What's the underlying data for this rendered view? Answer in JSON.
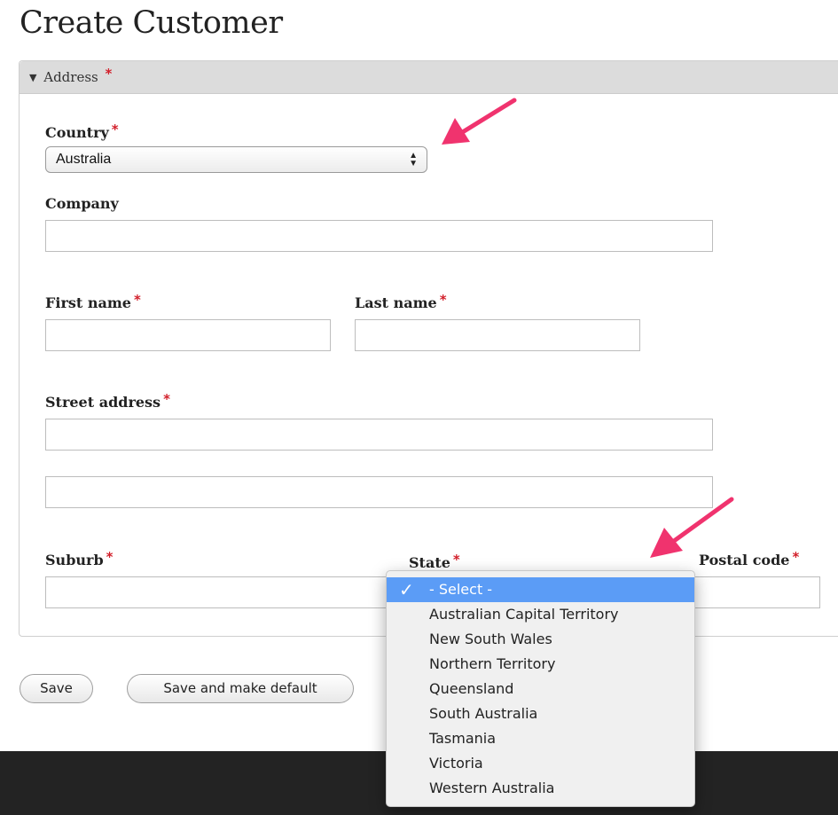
{
  "page_title": "Create Customer",
  "address_section": {
    "legend_label": "Address",
    "required_mark": "*",
    "country": {
      "label": "Country",
      "selected": "Australia"
    },
    "company": {
      "label": "Company",
      "value": ""
    },
    "first_name": {
      "label": "First name",
      "value": ""
    },
    "last_name": {
      "label": "Last name",
      "value": ""
    },
    "street_address": {
      "label": "Street address",
      "line1": "",
      "line2": ""
    },
    "suburb": {
      "label": "Suburb",
      "value": ""
    },
    "state": {
      "label": "State",
      "selected": "- Select -",
      "options": [
        "- Select -",
        "Australian Capital Territory",
        "New South Wales",
        "Northern Territory",
        "Queensland",
        "South Australia",
        "Tasmania",
        "Victoria",
        "Western Australia"
      ]
    },
    "postal_code": {
      "label": "Postal code",
      "value": ""
    }
  },
  "buttons": {
    "save": "Save",
    "save_default": "Save and make default"
  },
  "colors": {
    "required": "#d21f2a",
    "highlight": "#5b9cf6",
    "annotation_arrow": "#f0336e",
    "footer": "#232323"
  }
}
